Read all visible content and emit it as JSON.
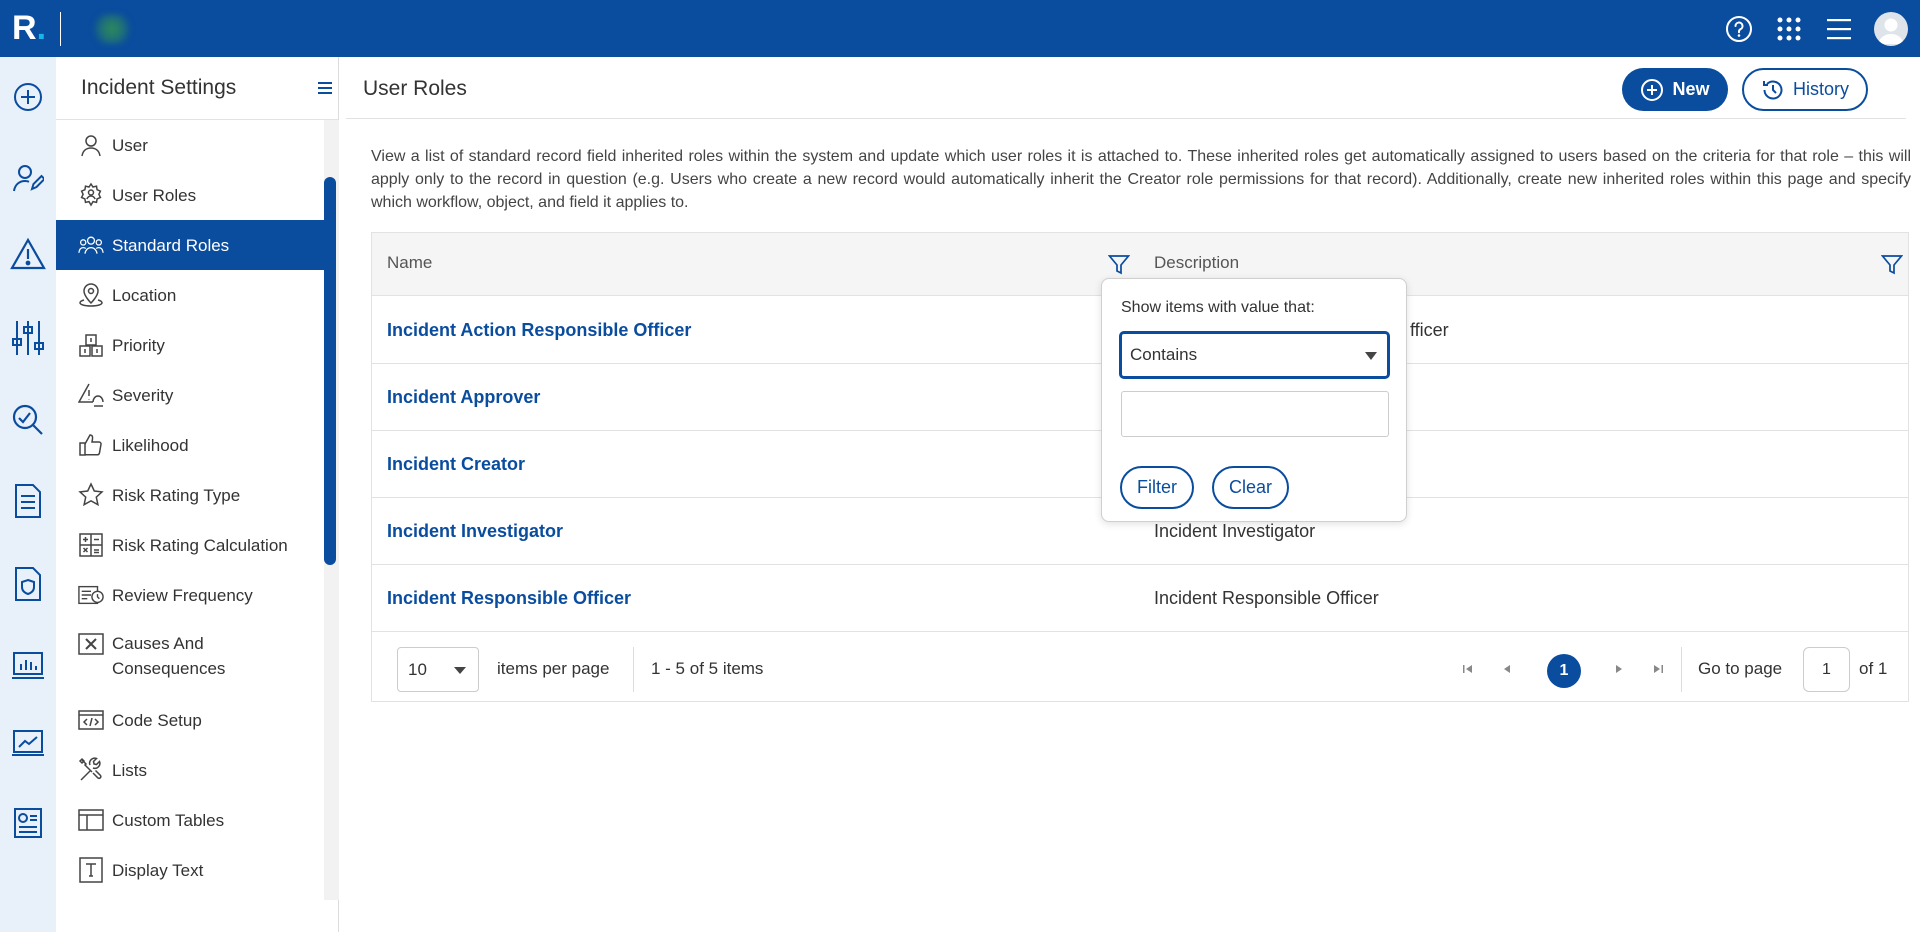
{
  "topbar": {
    "logo_letter": "R",
    "logo_dot": ".",
    "help_icon": "help-circle-icon",
    "apps_icon": "apps-grid-icon",
    "menu_icon": "hamburger-icon",
    "avatar_icon": "user-avatar-icon",
    "color": "#0a4c9e"
  },
  "rail": {
    "icons": [
      "plus-circle-icon",
      "user-edit-icon",
      "warning-triangle-icon",
      "sliders-icon",
      "magnifier-chart-icon",
      "document-icon",
      "document-shield-icon",
      "bar-chart-monitor-icon",
      "trend-monitor-icon",
      "report-icon"
    ]
  },
  "settings": {
    "title": "Incident Settings",
    "items": [
      {
        "label": "User",
        "icon": "user-icon"
      },
      {
        "label": "User Roles",
        "icon": "gear-user-icon"
      },
      {
        "label": "Standard Roles",
        "icon": "users-group-icon",
        "active": true
      },
      {
        "label": "Location",
        "icon": "location-pin-icon"
      },
      {
        "label": "Priority",
        "icon": "priority-blocks-icon"
      },
      {
        "label": "Severity",
        "icon": "severity-icon"
      },
      {
        "label": "Likelihood",
        "icon": "thumbs-up-icon"
      },
      {
        "label": "Risk Rating Type",
        "icon": "star-icon"
      },
      {
        "label": "Risk Rating Calculation",
        "icon": "calculator-icon"
      },
      {
        "label": "Review Frequency",
        "icon": "review-frequency-icon"
      },
      {
        "label": "Causes And Consequences",
        "icon": "x-box-icon"
      },
      {
        "label": "Code Setup",
        "icon": "code-icon"
      },
      {
        "label": "Lists",
        "icon": "tools-icon"
      },
      {
        "label": "Custom Tables",
        "icon": "table-icon"
      },
      {
        "label": "Display Text",
        "icon": "text-box-icon"
      }
    ]
  },
  "main": {
    "title": "User Roles",
    "new_label": "New",
    "history_label": "History",
    "intro": "View a list of standard record field inherited roles within the system and update which user roles it is attached to. These inherited roles get automatically assigned to users based on the criteria for that role – this will apply only to the record in question (e.g. Users who create a new record would automatically inherit the Creator role permissions for that record). Additionally, create new inherited roles within this page and specify which workflow, object, and field it applies to."
  },
  "grid": {
    "columns": [
      "Name",
      "Description"
    ],
    "rows": [
      {
        "name": "Incident Action Responsible Officer",
        "description": "Incident Action Responsible Officer"
      },
      {
        "name": "Incident Approver",
        "description": ""
      },
      {
        "name": "Incident Creator",
        "description": ""
      },
      {
        "name": "Incident Investigator",
        "description": "Incident Investigator"
      },
      {
        "name": "Incident Responsible Officer",
        "description": "Incident Responsible Officer"
      }
    ],
    "visible_desc_fragment_row1": "fficer"
  },
  "pager": {
    "page_size": "10",
    "items_per_page": "items per page",
    "info": "1 - 5 of 5 items",
    "current_page": "1",
    "goto_label": "Go to page",
    "goto_value": "1",
    "of_label": "of 1"
  },
  "filter_popup": {
    "label": "Show items with value that:",
    "operator": "Contains",
    "value": "",
    "filter_label": "Filter",
    "clear_label": "Clear"
  }
}
